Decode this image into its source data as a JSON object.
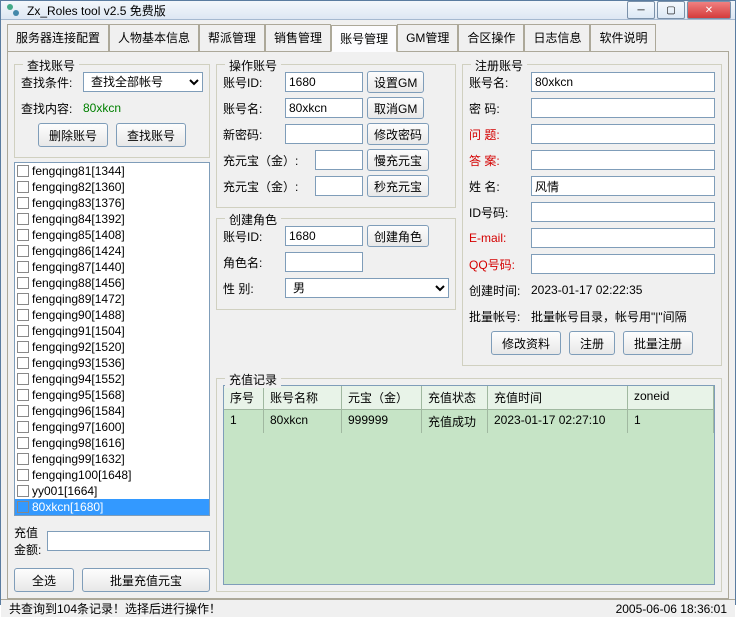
{
  "window": {
    "title": "Zx_Roles tool v2.5 免费版"
  },
  "tabs": [
    "服务器连接配置",
    "人物基本信息",
    "帮派管理",
    "销售管理",
    "账号管理",
    "GM管理",
    "合区操作",
    "日志信息",
    "软件说明"
  ],
  "activeTab": "账号管理",
  "search": {
    "legend": "查找账号",
    "condLabel": "查找条件:",
    "condValue": "查找全部帐号",
    "contentLabel": "查找内容:",
    "contentValue": "80xkcn",
    "deleteBtn": "删除账号",
    "findBtn": "查找账号"
  },
  "accountList": [
    "fengqing81[1344]",
    "fengqing82[1360]",
    "fengqing83[1376]",
    "fengqing84[1392]",
    "fengqing85[1408]",
    "fengqing86[1424]",
    "fengqing87[1440]",
    "fengqing88[1456]",
    "fengqing89[1472]",
    "fengqing90[1488]",
    "fengqing91[1504]",
    "fengqing92[1520]",
    "fengqing93[1536]",
    "fengqing94[1552]",
    "fengqing95[1568]",
    "fengqing96[1584]",
    "fengqing97[1600]",
    "fengqing98[1616]",
    "fengqing99[1632]",
    "fengqing100[1648]",
    "yy001[1664]",
    "80xkcn[1680]"
  ],
  "selectedIndex": 21,
  "amountLabel": "充值金额:",
  "amountValue": "",
  "selectAllBtn": "全选",
  "batchRechargeBtn": "批量充值元宝",
  "operate": {
    "legend": "操作账号",
    "idLabel": "账号ID:",
    "idValue": "1680",
    "setGmBtn": "设置GM",
    "nameLabel": "账号名:",
    "nameValue": "80xkcn",
    "cancelGmBtn": "取消GM",
    "newPwdLabel": "新密码:",
    "newPwdValue": "",
    "changePwdBtn": "修改密码",
    "gold1Label": "充元宝（金）:",
    "gold1Value": "",
    "slowBtn": "慢充元宝",
    "gold2Label": "充元宝（金）:",
    "gold2Value": "",
    "fastBtn": "秒充元宝"
  },
  "createRole": {
    "legend": "创建角色",
    "idLabel": "账号ID:",
    "idValue": "1680",
    "createBtn": "创建角色",
    "roleNameLabel": "角色名:",
    "roleNameValue": "",
    "genderLabel": "性 别:",
    "genderValue": "男"
  },
  "register": {
    "legend": "注册账号",
    "nameLabel": "账号名:",
    "nameValue": "80xkcn",
    "pwdLabel": "密 码:",
    "pwdValue": "",
    "questionLabel": "问 题:",
    "questionValue": "",
    "answerLabel": "答 案:",
    "answerValue": "",
    "realNameLabel": "姓 名:",
    "realNameValue": "风情",
    "idcardLabel": "ID号码:",
    "idcardValue": "",
    "emailLabel": "E-mail:",
    "emailValue": "",
    "qqLabel": "QQ号码:",
    "qqValue": "",
    "createTimeLabel": "创建时间:",
    "createTimeValue": "2023-01-17 02:22:35",
    "batchLabel": "批量帐号:",
    "batchHint": "批量帐号目录，帐号用\"|\"间隔",
    "modifyBtn": "修改资料",
    "registerBtn": "注册",
    "batchRegisterBtn": "批量注册"
  },
  "recharge": {
    "legend": "充值记录",
    "headers": {
      "seq": "序号",
      "name": "账号名称",
      "gold": "元宝（金）",
      "status": "充值状态",
      "time": "充值时间",
      "zone": "zoneid"
    },
    "rows": [
      {
        "seq": "1",
        "name": "80xkcn",
        "gold": "999999",
        "status": "充值成功",
        "time": "2023-01-17 02:27:10",
        "zone": "1"
      }
    ]
  },
  "statusLeft": "共查询到104条记录！选择后进行操作！",
  "statusRight": "2005-06-06 18:36:01"
}
